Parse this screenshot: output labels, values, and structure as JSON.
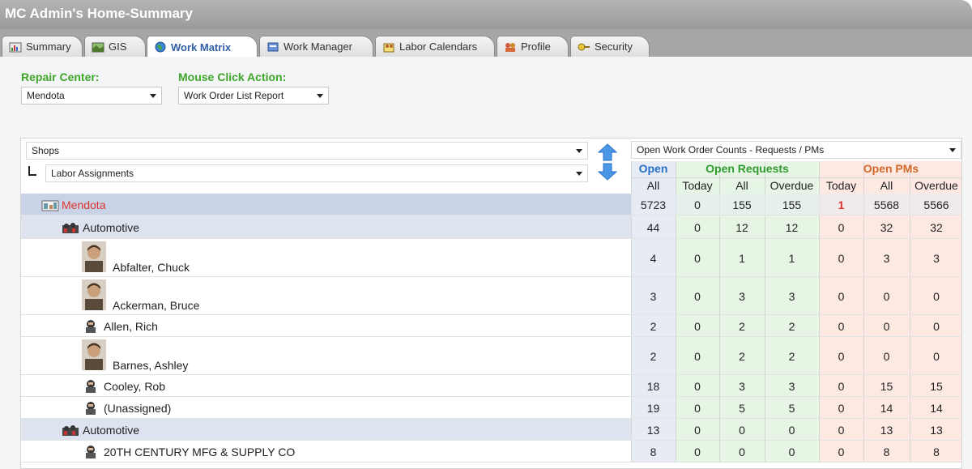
{
  "window": {
    "title": "MC Admin's Home-Summary"
  },
  "tabs": [
    {
      "label": "Summary",
      "icon": "summary-chart-icon",
      "active": false
    },
    {
      "label": "GIS",
      "icon": "map-icon",
      "active": false
    },
    {
      "label": "Work Matrix",
      "icon": "globe-icon",
      "active": true
    },
    {
      "label": "Work Manager",
      "icon": "work-manager-icon",
      "active": false
    },
    {
      "label": "Labor Calendars",
      "icon": "labor-calendar-icon",
      "active": false
    },
    {
      "label": "Profile",
      "icon": "profile-icon",
      "active": false
    },
    {
      "label": "Security",
      "icon": "security-key-icon",
      "active": false
    }
  ],
  "filters": {
    "repair_center_label": "Repair Center:",
    "repair_center_value": "Mendota",
    "mouse_click_label": "Mouse Click Action:",
    "mouse_click_value": "Work Order List Report"
  },
  "tree_selectors": {
    "level1": "Shops",
    "level2": "Labor Assignments"
  },
  "counts_selector": "Open Work Order Counts - Requests / PMs",
  "header": {
    "open": "Open",
    "open_requests": "Open Requests",
    "open_pms": "Open PMs",
    "sub": [
      "All",
      "Today",
      "All",
      "Overdue",
      "Today",
      "All",
      "Overdue"
    ]
  },
  "colors": {
    "open_blue": "#2a6fc9",
    "requests_green": "#2f9a2f",
    "pms_orange": "#d2692b",
    "root_red": "#e0332b"
  },
  "rows": [
    {
      "name": "Mendota",
      "kind": "root",
      "icon": "site-icon",
      "values": [
        "5723",
        "0",
        "155",
        "155",
        "1",
        "5568",
        "5566"
      ]
    },
    {
      "name": "Automotive",
      "kind": "shop",
      "icon": "shop-icon",
      "values": [
        "44",
        "0",
        "12",
        "12",
        "0",
        "32",
        "32"
      ]
    },
    {
      "name": "Abfalter, Chuck",
      "kind": "labor-photo",
      "icon": "person-photo-icon",
      "values": [
        "4",
        "0",
        "1",
        "1",
        "0",
        "3",
        "3"
      ]
    },
    {
      "name": "Ackerman, Bruce",
      "kind": "labor-photo",
      "icon": "person-photo-icon",
      "values": [
        "3",
        "0",
        "3",
        "3",
        "0",
        "0",
        "0"
      ]
    },
    {
      "name": "Allen, Rich",
      "kind": "labor",
      "icon": "person-icon",
      "values": [
        "2",
        "0",
        "2",
        "2",
        "0",
        "0",
        "0"
      ]
    },
    {
      "name": "Barnes, Ashley",
      "kind": "labor-photo",
      "icon": "person-photo-icon",
      "values": [
        "2",
        "0",
        "2",
        "2",
        "0",
        "0",
        "0"
      ]
    },
    {
      "name": "Cooley, Rob",
      "kind": "labor",
      "icon": "person-icon",
      "values": [
        "18",
        "0",
        "3",
        "3",
        "0",
        "15",
        "15"
      ]
    },
    {
      "name": "(Unassigned)",
      "kind": "labor",
      "icon": "person-icon",
      "values": [
        "19",
        "0",
        "5",
        "5",
        "0",
        "14",
        "14"
      ]
    },
    {
      "name": "Automotive",
      "kind": "shop",
      "icon": "shop-icon",
      "values": [
        "13",
        "0",
        "0",
        "0",
        "0",
        "13",
        "13"
      ]
    },
    {
      "name": "20TH CENTURY MFG & SUPPLY CO",
      "kind": "labor",
      "icon": "person-icon",
      "values": [
        "8",
        "0",
        "0",
        "0",
        "0",
        "8",
        "8"
      ]
    }
  ]
}
